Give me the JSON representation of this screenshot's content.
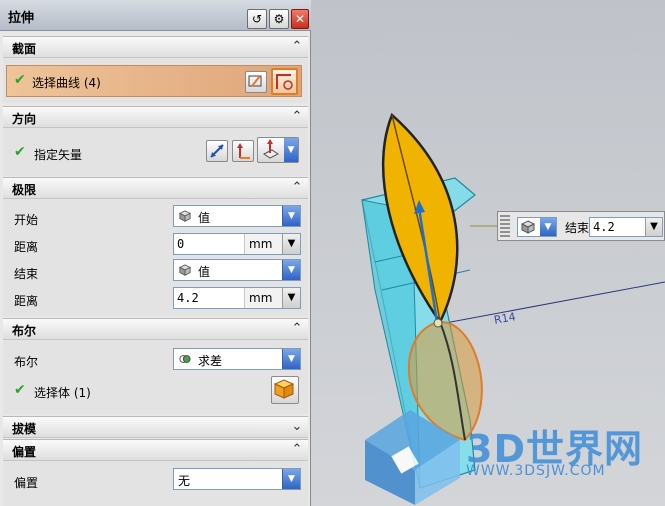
{
  "dialog": {
    "title": "拉伸",
    "title_buttons": [
      "reset-icon",
      "gear-icon",
      "close-icon"
    ]
  },
  "sections": {
    "section": {
      "title": "截面",
      "select_curve_label": "选择曲线 (4)"
    },
    "direction": {
      "title": "方向",
      "specify_vector_label": "指定矢量"
    },
    "limits": {
      "title": "极限",
      "start_label": "开始",
      "start_value": "值",
      "start_distance_label": "距离",
      "start_distance": "0",
      "start_unit": "mm",
      "end_label": "结束",
      "end_value": "值",
      "end_distance_label": "距离",
      "end_distance": "4.2",
      "end_unit": "mm"
    },
    "boolean": {
      "title": "布尔",
      "boolean_label": "布尔",
      "boolean_value": "求差",
      "select_body_label": "选择体 (1)"
    },
    "draft": {
      "title": "拔模"
    },
    "offset": {
      "title": "偏置",
      "offset_label": "偏置",
      "offset_value": "无"
    }
  },
  "viewport": {
    "floating_end_label": "结束",
    "floating_end_value": "4.2",
    "dimension_label": "R14"
  },
  "watermark": {
    "text": "3D世界网",
    "url": "WWW.3DSJW.COM"
  },
  "colors": {
    "accent_orange": "#e07b2a",
    "check_green": "#2aa52a",
    "body_cyan": "#6fe0f0",
    "leaf_yellow": "#f0b400"
  }
}
